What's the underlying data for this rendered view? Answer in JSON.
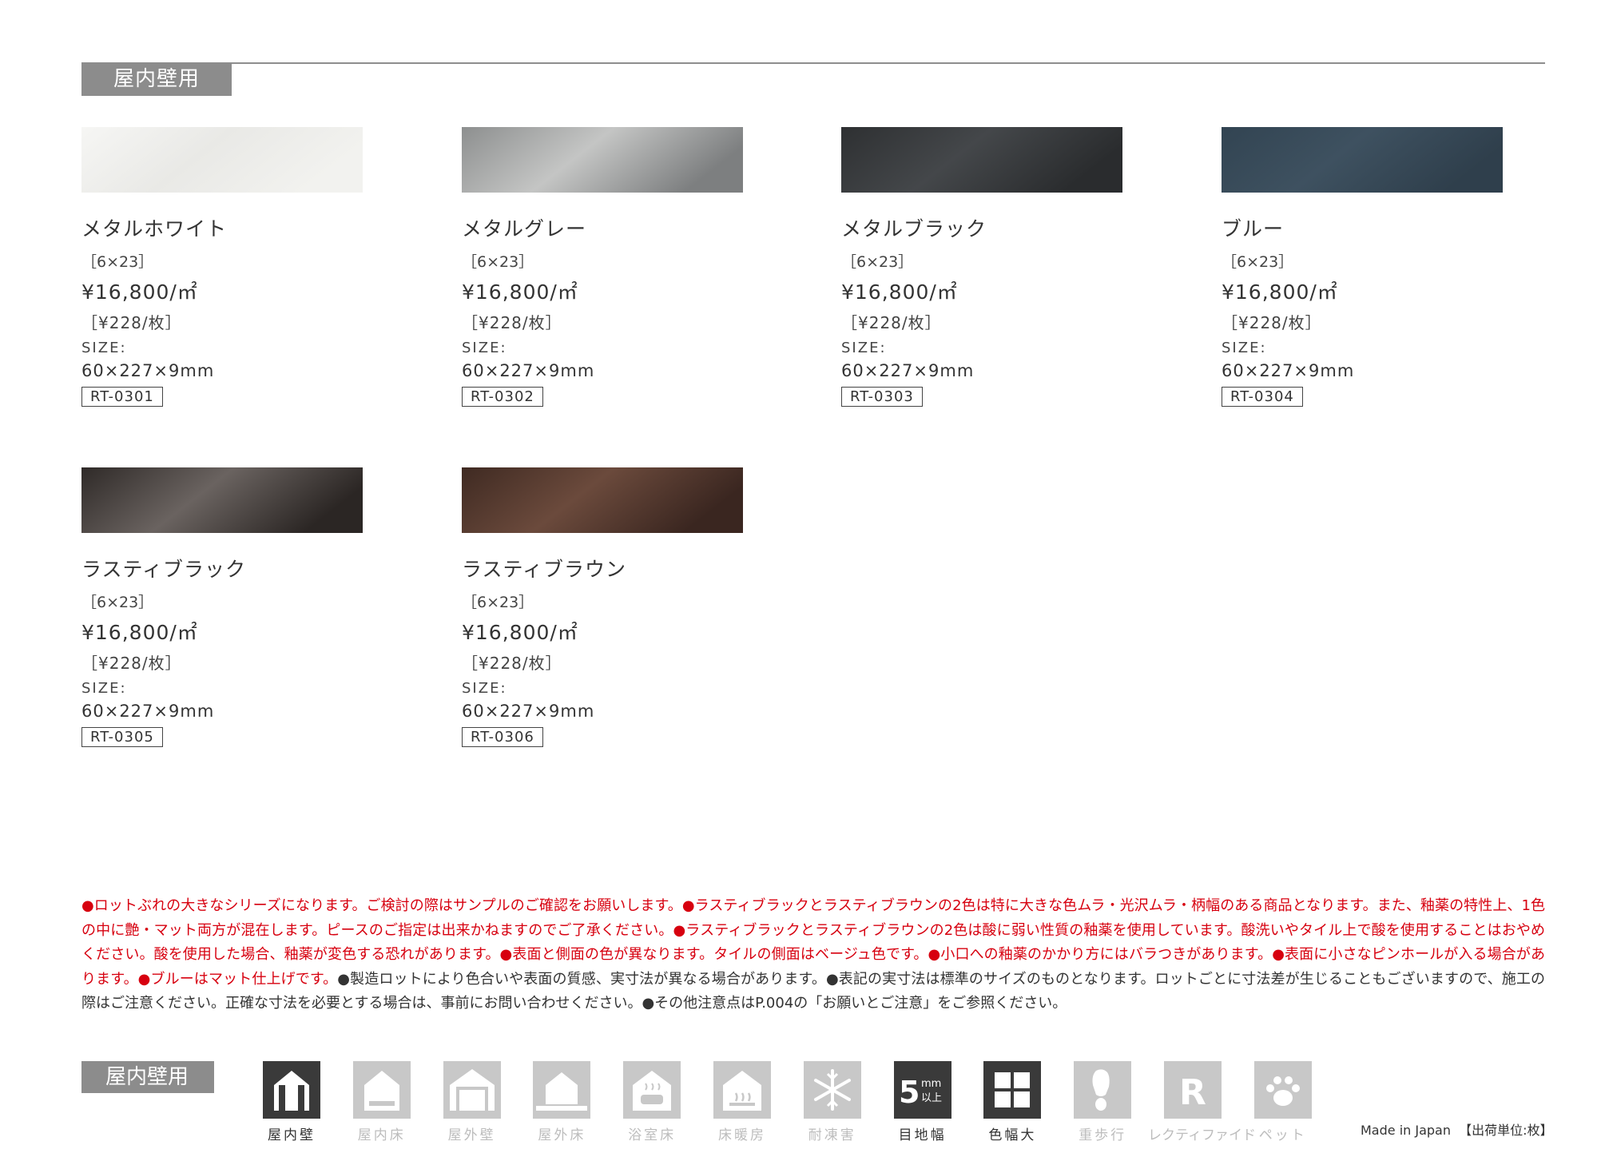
{
  "section_title": "屋内壁用",
  "products": [
    {
      "name": "メタルホワイト",
      "grid": "［6×23］",
      "price": "¥16,800/㎡",
      "unit_price": "［¥228/枚］",
      "size_label": "SIZE:",
      "size": "60×227×9mm",
      "code": "RT-0301",
      "swatch": {
        "c1": "#f6f6f4",
        "c2": "#e9e9e6",
        "c3": "#f2f2ef"
      }
    },
    {
      "name": "メタルグレー",
      "grid": "［6×23］",
      "price": "¥16,800/㎡",
      "unit_price": "［¥228/枚］",
      "size_label": "SIZE:",
      "size": "60×227×9mm",
      "code": "RT-0302",
      "swatch": {
        "c1": "#8d8f8f",
        "c2": "#c4c5c4",
        "c3": "#7d7f80"
      }
    },
    {
      "name": "メタルブラック",
      "grid": "［6×23］",
      "price": "¥16,800/㎡",
      "unit_price": "［¥228/枚］",
      "size_label": "SIZE:",
      "size": "60×227×9mm",
      "code": "RT-0303",
      "swatch": {
        "c1": "#2e3032",
        "c2": "#44474a",
        "c3": "#2a2c2e"
      }
    },
    {
      "name": "ブルー",
      "grid": "［6×23］",
      "price": "¥16,800/㎡",
      "unit_price": "［¥228/枚］",
      "size_label": "SIZE:",
      "size": "60×227×9mm",
      "code": "RT-0304",
      "swatch": {
        "c1": "#324452",
        "c2": "#3e5160",
        "c3": "#2f3f4c"
      }
    },
    {
      "name": "ラスティブラック",
      "grid": "［6×23］",
      "price": "¥16,800/㎡",
      "unit_price": "［¥228/枚］",
      "size_label": "SIZE:",
      "size": "60×227×9mm",
      "code": "RT-0305",
      "swatch": {
        "c1": "#2f2a28",
        "c2": "#6a6360",
        "c3": "#2b2624"
      }
    },
    {
      "name": "ラスティブラウン",
      "grid": "［6×23］",
      "price": "¥16,800/㎡",
      "unit_price": "［¥228/枚］",
      "size_label": "SIZE:",
      "size": "60×227×9mm",
      "code": "RT-0306",
      "swatch": {
        "c1": "#3f2a22",
        "c2": "#6b4a3c",
        "c3": "#3a2620"
      }
    }
  ],
  "notes": {
    "red": "●ロットぶれの大きなシリーズになります。ご検討の際はサンプルのご確認をお願いします。●ラスティブラックとラスティブラウンの2色は特に大きな色ムラ・光沢ムラ・柄幅のある商品となります。また、釉薬の特性上、1色の中に艶・マット両方が混在します。ピースのご指定は出来かねますのでご了承ください。●ラスティブラックとラスティブラウンの2色は酸に弱い性質の釉薬を使用しています。酸洗いやタイル上で酸を使用することはおやめください。酸を使用した場合、釉薬が変色する恐れがあります。●表面と側面の色が異なります。タイルの側面はベージュ色です。●小口への釉薬のかかり方にはバラつきがあります。●表面に小さなピンホールが入る場合があります。●ブルーはマット仕上げです。",
    "black": "●製造ロットにより色合いや表面の質感、実寸法が異なる場合があります。●表記の実寸法は標準のサイズのものとなります。ロットごとに寸法差が生じることもございますので、施工の際はご注意ください。正確な寸法を必要とする場合は、事前にお問い合わせください。●その他注意点はP.004の「お願いとご注意」をご参照ください。"
  },
  "usage": {
    "title": "屋内壁用",
    "icons": [
      {
        "label": "屋内壁",
        "icon": "interior-wall-icon",
        "active": true
      },
      {
        "label": "屋内床",
        "icon": "interior-floor-icon",
        "active": false
      },
      {
        "label": "屋外壁",
        "icon": "exterior-wall-icon",
        "active": false
      },
      {
        "label": "屋外床",
        "icon": "exterior-floor-icon",
        "active": false
      },
      {
        "label": "浴室床",
        "icon": "bathroom-floor-icon",
        "active": false
      },
      {
        "label": "床暖房",
        "icon": "floor-heating-icon",
        "active": false
      },
      {
        "label": "耐凍害",
        "icon": "frost-resistant-icon",
        "active": false
      },
      {
        "label": "目地幅",
        "icon": "joint-width-icon",
        "active": true,
        "value": "5",
        "unit_top": "mm",
        "unit_bottom": "以上"
      },
      {
        "label": "色幅大",
        "icon": "color-variation-icon",
        "active": true
      },
      {
        "label": "重歩行",
        "icon": "heavy-traffic-icon",
        "active": false
      },
      {
        "label": "レクティファイド",
        "icon": "rectified-icon",
        "active": false,
        "glyph": "R"
      },
      {
        "label": "ペット",
        "icon": "pet-icon",
        "active": false
      }
    ],
    "colors": {
      "active": "#3a3a3a",
      "inactive": "#c8c8c8"
    }
  },
  "footer": {
    "made_in": "Made in Japan",
    "shipping_unit": "【出荷単位:枚】"
  }
}
